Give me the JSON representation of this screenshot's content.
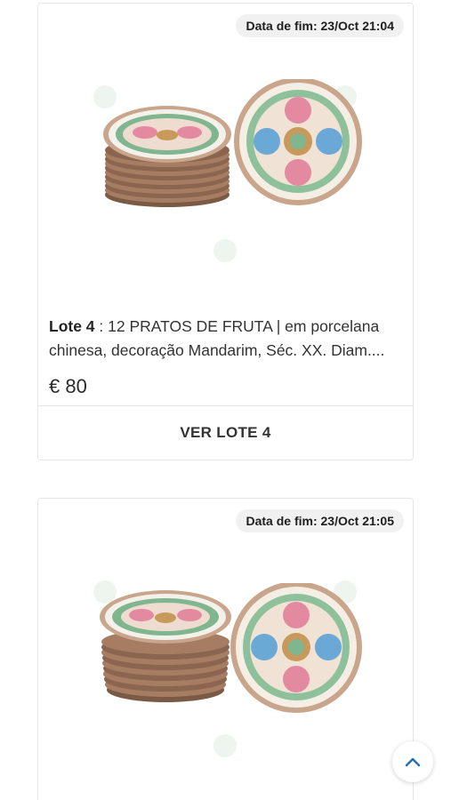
{
  "lots": [
    {
      "end_label": "Data de fim:",
      "end_date": "23/Oct 21:04",
      "lot_label": "Lote 4",
      "separator": " : ",
      "description": "12 PRATOS DE FRUTA | em porcelana chinesa, decoração Mandarim, Séc. XX. Diam....",
      "price": "€ 80",
      "view_button": "VER LOTE 4"
    },
    {
      "end_label": "Data de fim:",
      "end_date": "23/Oct 21:05"
    }
  ],
  "scroll_top_icon": "chevron-up-icon",
  "colors": {
    "accent": "#2f6fb3",
    "card_border": "#e6e6e6",
    "badge_bg": "#f1f1f1"
  }
}
